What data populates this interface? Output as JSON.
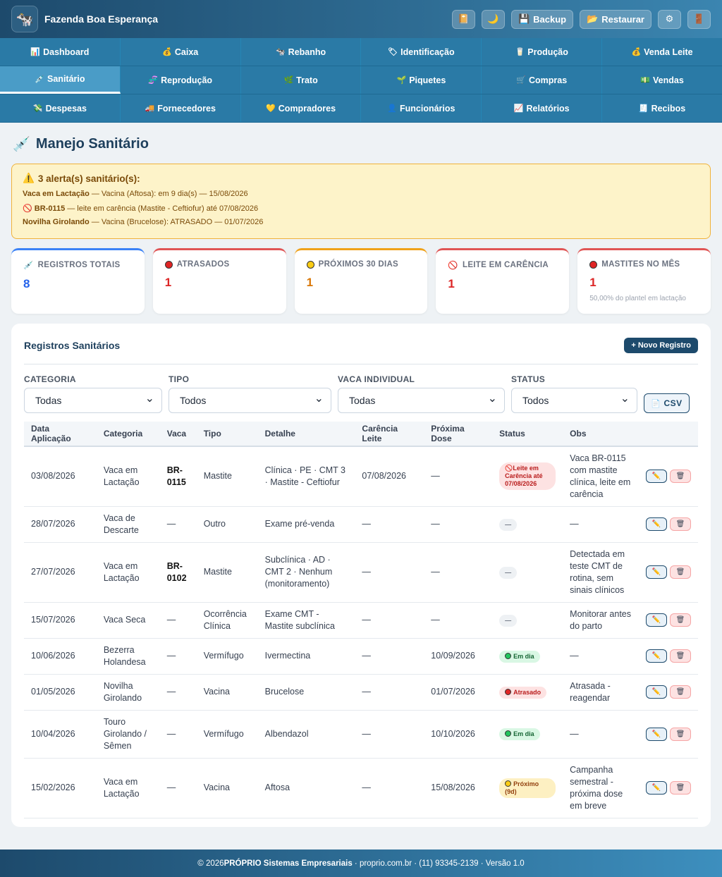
{
  "app": {
    "title": "Fazenda Boa Esperança",
    "logo_icon": "🐄"
  },
  "header": {
    "backup_label": "Backup",
    "restore_label": "Restaurar"
  },
  "nav": {
    "rows": [
      [
        {
          "label": "Dashboard",
          "icon": "📊"
        },
        {
          "label": "Caixa",
          "icon": "💰"
        },
        {
          "label": "Rebanho",
          "icon": "🐄"
        },
        {
          "label": "Identificação",
          "icon": "🏷"
        },
        {
          "label": "Produção",
          "icon": "🥛"
        },
        {
          "label": "Venda Leite",
          "icon": "💰"
        }
      ],
      [
        {
          "label": "Sanitário",
          "icon": "💉"
        },
        {
          "label": "Reprodução",
          "icon": "🧬"
        },
        {
          "label": "Trato",
          "icon": "🌿"
        },
        {
          "label": "Piquetes",
          "icon": "🌱"
        },
        {
          "label": "Compras",
          "icon": "🛒"
        },
        {
          "label": "Vendas",
          "icon": "💵"
        }
      ],
      [
        {
          "label": "Despesas",
          "icon": "💸"
        },
        {
          "label": "Fornecedores",
          "icon": "🚚"
        },
        {
          "label": "Compradores",
          "icon": "💛"
        },
        {
          "label": "Funcionários",
          "icon": "👤"
        },
        {
          "label": "Relatórios",
          "icon": "📈"
        },
        {
          "label": "Recibos",
          "icon": "🧾"
        }
      ]
    ],
    "active": "Sanitário"
  },
  "page": {
    "title": "Manejo Sanitário"
  },
  "alerts": {
    "title": "3 alerta(s) sanitário(s):",
    "items": [
      {
        "prefix": "",
        "subject": "Vaca em Lactação",
        "text": " — Vacina (Aftosa): em 9 dia(s) — 15/08/2026"
      },
      {
        "prefix": "🚫 ",
        "subject": "BR-0115",
        "text": " — leite em carência (Mastite - Ceftiofur) até 07/08/2026"
      },
      {
        "prefix": "",
        "subject": "Novilha Girolando",
        "text": " — Vacina (Brucelose): ATRASADO — 01/07/2026"
      }
    ]
  },
  "stats": [
    {
      "label": "REGISTROS TOTAIS",
      "value": "8",
      "sub": "",
      "color": "#3b82f6",
      "val_color": "#2563eb",
      "icon": "💉"
    },
    {
      "label": "ATRASADOS",
      "value": "1",
      "sub": "",
      "color": "#e05555",
      "val_color": "#dc2626",
      "icon": "dot-red"
    },
    {
      "label": "PRÓXIMOS 30 DIAS",
      "value": "1",
      "sub": "",
      "color": "#f0a21a",
      "val_color": "#d97706",
      "icon": "dot-yellow"
    },
    {
      "label": "LEITE EM CARÊNCIA",
      "value": "1",
      "sub": "",
      "color": "#e05555",
      "val_color": "#dc2626",
      "icon": "🚫"
    },
    {
      "label": "MASTITES NO MÊS",
      "value": "1",
      "sub": "50,00% do plantel em lactação",
      "color": "#e05555",
      "val_color": "#dc2626",
      "icon": "dot-red"
    }
  ],
  "registros": {
    "title": "Registros Sanitários",
    "new_label": "+ Novo Registro",
    "filters": [
      {
        "label": "CATEGORIA",
        "value": "Todas"
      },
      {
        "label": "TIPO",
        "value": "Todos"
      },
      {
        "label": "VACA INDIVIDUAL",
        "value": "Todas"
      },
      {
        "label": "STATUS",
        "value": "Todos"
      }
    ],
    "csv_label": "CSV",
    "columns": [
      "Data Aplicação",
      "Categoria",
      "Vaca",
      "Tipo",
      "Detalhe",
      "Carência Leite",
      "Próxima Dose",
      "Status",
      "Obs"
    ],
    "rows": [
      {
        "data": "03/08/2026",
        "categoria": "Vaca em Lactação",
        "vaca": "BR-0115",
        "tipo": "Mastite",
        "detalhe": "Clínica · PE · CMT 3 · Mastite - Ceftiofur",
        "carencia": "07/08/2026",
        "proxima": "—",
        "status": "Leite em Carência até 07/08/2026",
        "status_kind": "red",
        "status_icon": "🚫",
        "obs": "Vaca BR-0115 com mastite clínica, leite em carência"
      },
      {
        "data": "28/07/2026",
        "categoria": "Vaca de Descarte",
        "vaca": "—",
        "tipo": "Outro",
        "detalhe": "Exame pré-venda",
        "carencia": "—",
        "proxima": "—",
        "status": "—",
        "status_kind": "gray",
        "status_icon": "",
        "obs": "—"
      },
      {
        "data": "27/07/2026",
        "categoria": "Vaca em Lactação",
        "vaca": "BR-0102",
        "tipo": "Mastite",
        "detalhe": "Subclínica · AD · CMT 2 · Nenhum (monitoramento)",
        "carencia": "—",
        "proxima": "—",
        "status": "—",
        "status_kind": "gray",
        "status_icon": "",
        "obs": "Detectada em teste CMT de rotina, sem sinais clínicos"
      },
      {
        "data": "15/07/2026",
        "categoria": "Vaca Seca",
        "vaca": "—",
        "tipo": "Ocorrência Clínica",
        "detalhe": "Exame CMT - Mastite subclínica",
        "carencia": "—",
        "proxima": "—",
        "status": "—",
        "status_kind": "gray",
        "status_icon": "",
        "obs": "Monitorar antes do parto"
      },
      {
        "data": "10/06/2026",
        "categoria": "Bezerra Holandesa",
        "vaca": "—",
        "tipo": "Vermífugo",
        "detalhe": "Ivermectina",
        "carencia": "—",
        "proxima": "10/09/2026",
        "status": "Em dia",
        "status_kind": "green",
        "status_icon": "dot-green",
        "obs": "—"
      },
      {
        "data": "01/05/2026",
        "categoria": "Novilha Girolando",
        "vaca": "—",
        "tipo": "Vacina",
        "detalhe": "Brucelose",
        "carencia": "—",
        "proxima": "01/07/2026",
        "status": "Atrasado",
        "status_kind": "red",
        "status_icon": "dot-red",
        "obs": "Atrasada - reagendar"
      },
      {
        "data": "10/04/2026",
        "categoria": "Touro Girolando / Sêmen",
        "vaca": "—",
        "tipo": "Vermífugo",
        "detalhe": "Albendazol",
        "carencia": "—",
        "proxima": "10/10/2026",
        "status": "Em dia",
        "status_kind": "green",
        "status_icon": "dot-green",
        "obs": "—"
      },
      {
        "data": "15/02/2026",
        "categoria": "Vaca em Lactação",
        "vaca": "—",
        "tipo": "Vacina",
        "detalhe": "Aftosa",
        "carencia": "—",
        "proxima": "15/08/2026",
        "status": "Próximo (9d)",
        "status_kind": "yellow",
        "status_icon": "dot-yellow",
        "obs": "Campanha semestral - próxima dose em breve"
      }
    ]
  },
  "footer": {
    "prefix": "© 2026 ",
    "company": "PRÓPRIO Sistemas Empresariais",
    "rest": " · proprio.com.br · (11) 93345-2139 · Versão 1.0"
  }
}
